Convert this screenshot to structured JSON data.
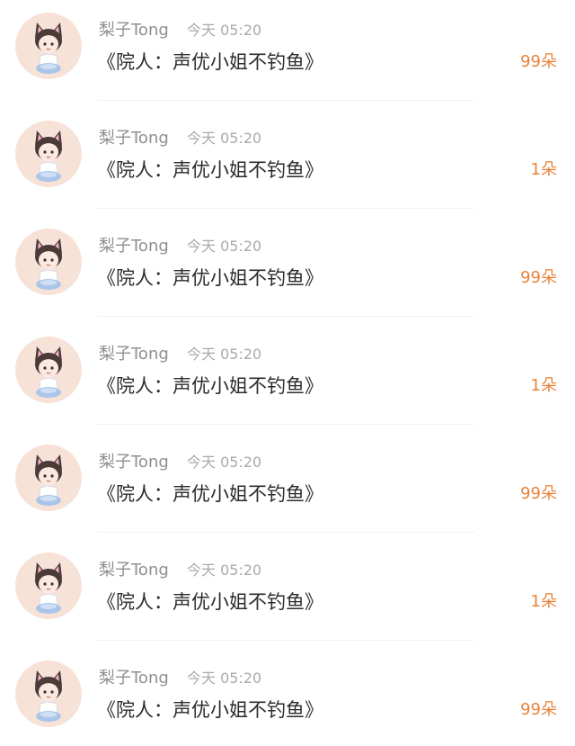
{
  "comments": [
    {
      "user": "梨子Tong",
      "time": "今天 05:20",
      "text": "《院人：声优小姐不钓鱼》",
      "count": "99朵"
    },
    {
      "user": "梨子Tong",
      "time": "今天 05:20",
      "text": "《院人：声优小姐不钓鱼》",
      "count": "1朵"
    },
    {
      "user": "梨子Tong",
      "time": "今天 05:20",
      "text": "《院人：声优小姐不钓鱼》",
      "count": "99朵"
    },
    {
      "user": "梨子Tong",
      "time": "今天 05:20",
      "text": "《院人：声优小姐不钓鱼》",
      "count": "1朵"
    },
    {
      "user": "梨子Tong",
      "time": "今天 05:20",
      "text": "《院人：声优小姐不钓鱼》",
      "count": "99朵"
    },
    {
      "user": "梨子Tong",
      "time": "今天 05:20",
      "text": "《院人：声优小姐不钓鱼》",
      "count": "1朵"
    },
    {
      "user": "梨子Tong",
      "time": "今天 05:20",
      "text": "《院人：声优小姐不钓鱼》",
      "count": "99朵"
    }
  ],
  "colors": {
    "avatar_bg": "#f7e2d7",
    "username": "#8f8f8f",
    "timestamp": "#a9a9a9",
    "content": "#2b2b2b",
    "count": "#e8843d",
    "divider": "#f1f1f1"
  },
  "icons": {
    "avatar": "chibi-cat-ear-character"
  }
}
